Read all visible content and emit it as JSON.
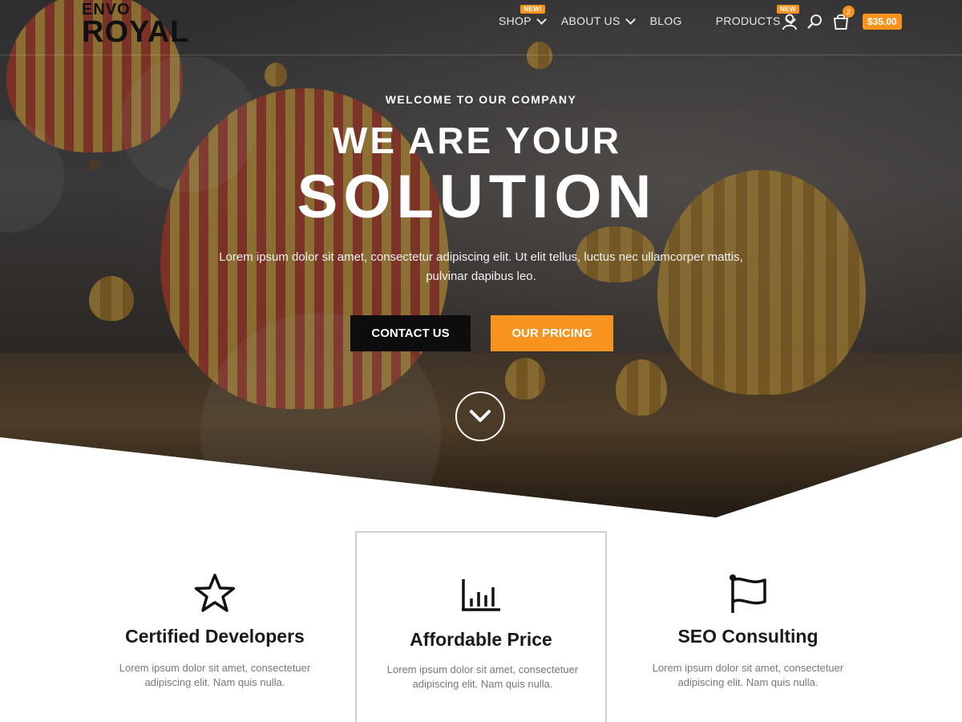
{
  "brand": {
    "top": "ENVO",
    "main": "ROYAL"
  },
  "nav": {
    "items": [
      {
        "label": "SHOP",
        "badge": "NEW!",
        "dropdown": true
      },
      {
        "label": "ABOUT US",
        "dropdown": true
      },
      {
        "label": "BLOG",
        "dropdown": false
      },
      {
        "label": "PRODUCTS",
        "badge": "NEW",
        "dropdown": true
      }
    ],
    "cart_count": "2",
    "cart_total": "$35.00"
  },
  "hero": {
    "eyebrow": "WELCOME TO OUR COMPANY",
    "title_line1": "WE ARE YOUR",
    "title_line2": "SOLUTION",
    "subtitle": "Lorem ipsum dolor sit amet, consectetur adipiscing elit. Ut elit tellus, luctus nec ullamcorper mattis, pulvinar dapibus leo.",
    "primary_button": "CONTACT US",
    "secondary_button": "OUR PRICING"
  },
  "features": [
    {
      "icon": "star-icon",
      "title": "Certified Developers",
      "text": "Lorem ipsum dolor sit amet, consectetuer adipiscing elit. Nam quis nulla."
    },
    {
      "icon": "bar-chart-icon",
      "title": "Affordable Price",
      "text": "Lorem ipsum dolor sit amet, consectetuer adipiscing elit. Nam quis nulla."
    },
    {
      "icon": "flag-icon",
      "title": "SEO Consulting",
      "text": "Lorem ipsum dolor sit amet, consectetuer adipiscing elit. Nam quis nulla."
    }
  ],
  "colors": {
    "accent": "#f7931e",
    "dark_button": "#0d0d0d"
  }
}
